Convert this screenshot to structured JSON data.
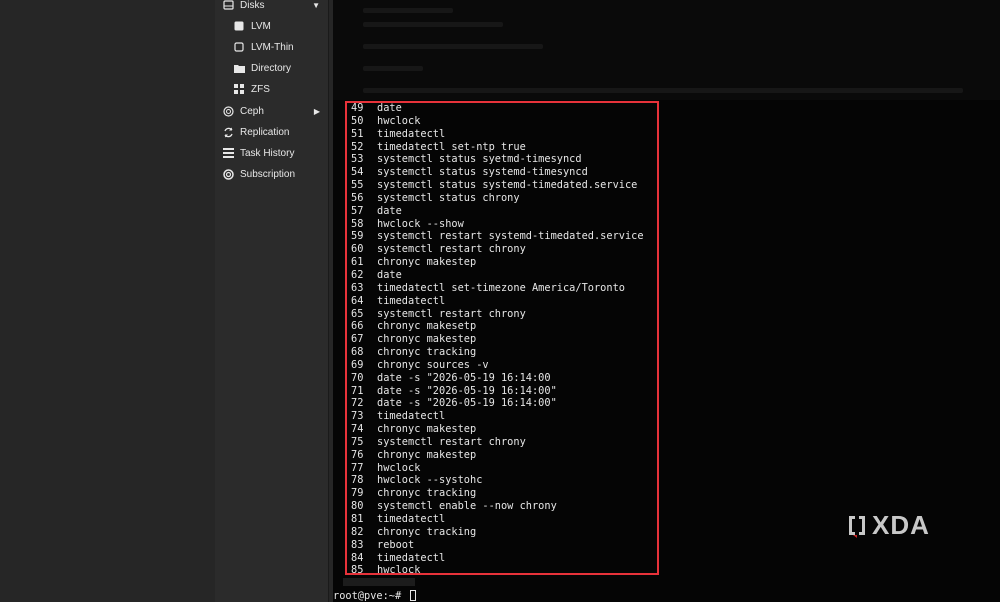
{
  "sidebar": {
    "items": [
      {
        "label": "Disks",
        "icon": "disk-icon",
        "level": "top",
        "chevron": "down"
      },
      {
        "label": "LVM",
        "icon": "lvm-icon",
        "level": "sub"
      },
      {
        "label": "LVM-Thin",
        "icon": "lvm-thin-icon",
        "level": "sub"
      },
      {
        "label": "Directory",
        "icon": "folder-icon",
        "level": "sub"
      },
      {
        "label": "ZFS",
        "icon": "zfs-grid-icon",
        "level": "sub"
      },
      {
        "label": "Ceph",
        "icon": "ceph-icon",
        "level": "top",
        "chevron": "right"
      },
      {
        "label": "Replication",
        "icon": "replication-icon",
        "level": "top"
      },
      {
        "label": "Task History",
        "icon": "task-list-icon",
        "level": "top"
      },
      {
        "label": "Subscription",
        "icon": "lifebuoy-icon",
        "level": "top"
      }
    ]
  },
  "terminal": {
    "history": [
      {
        "num": "49",
        "cmd": "date"
      },
      {
        "num": "50",
        "cmd": "hwclock"
      },
      {
        "num": "51",
        "cmd": "timedatectl"
      },
      {
        "num": "52",
        "cmd": "timedatectl set-ntp true"
      },
      {
        "num": "53",
        "cmd": "systemctl status syetmd-timesyncd"
      },
      {
        "num": "54",
        "cmd": "systemctl status systemd-timesyncd"
      },
      {
        "num": "55",
        "cmd": "systemctl status systemd-timedated.service"
      },
      {
        "num": "56",
        "cmd": "systemctl status chrony"
      },
      {
        "num": "57",
        "cmd": "date"
      },
      {
        "num": "58",
        "cmd": "hwclock --show"
      },
      {
        "num": "59",
        "cmd": "systemctl restart systemd-timedated.service"
      },
      {
        "num": "60",
        "cmd": "systemctl restart chrony"
      },
      {
        "num": "61",
        "cmd": "chronyc makestep"
      },
      {
        "num": "62",
        "cmd": "date"
      },
      {
        "num": "63",
        "cmd": "timedatectl set-timezone America/Toronto"
      },
      {
        "num": "64",
        "cmd": "timedatectl"
      },
      {
        "num": "65",
        "cmd": "systemctl restart chrony"
      },
      {
        "num": "66",
        "cmd": "chronyc makesetp"
      },
      {
        "num": "67",
        "cmd": "chronyc makestep"
      },
      {
        "num": "68",
        "cmd": "chronyc tracking"
      },
      {
        "num": "69",
        "cmd": "chronyc sources -v"
      },
      {
        "num": "70",
        "cmd": "date -s \"2026-05-19 16:14:00"
      },
      {
        "num": "71",
        "cmd": "date -s \"2026-05-19 16:14:00\""
      },
      {
        "num": "72",
        "cmd": "date -s \"2026-05-19 16:14:00\""
      },
      {
        "num": "73",
        "cmd": "timedatectl"
      },
      {
        "num": "74",
        "cmd": "chronyc makestep"
      },
      {
        "num": "75",
        "cmd": "systemctl restart chrony"
      },
      {
        "num": "76",
        "cmd": "chronyc makestep"
      },
      {
        "num": "77",
        "cmd": "hwclock"
      },
      {
        "num": "78",
        "cmd": "hwclock --systohc"
      },
      {
        "num": "79",
        "cmd": "chronyc tracking"
      },
      {
        "num": "80",
        "cmd": "systemctl enable --now chrony"
      },
      {
        "num": "81",
        "cmd": "timedatectl"
      },
      {
        "num": "82",
        "cmd": "chronyc tracking"
      },
      {
        "num": "83",
        "cmd": "reboot"
      },
      {
        "num": "84",
        "cmd": "timedatectl"
      },
      {
        "num": "85",
        "cmd": "hwclock"
      }
    ],
    "prompt": "root@pve:~#",
    "highlight_color": "#e8323a"
  },
  "watermark": {
    "text": "XDA"
  }
}
